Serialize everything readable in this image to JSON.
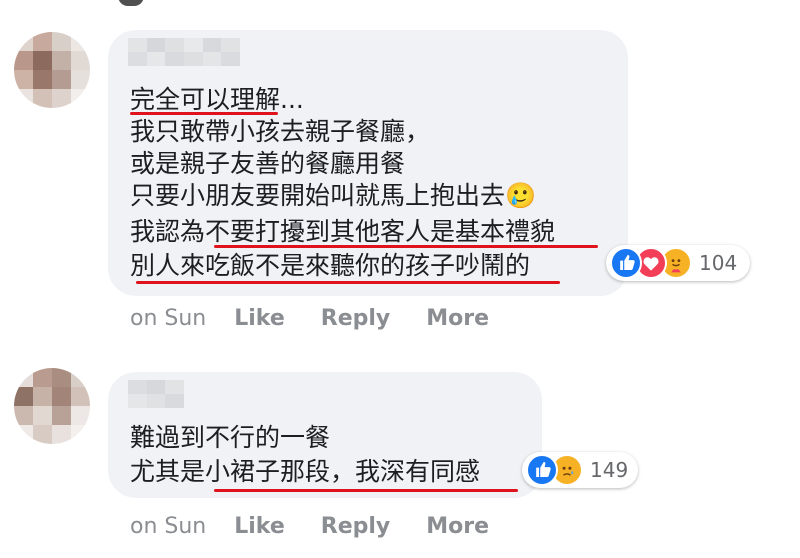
{
  "comments": [
    {
      "lines": [
        "完全可以理解...",
        "我只敢帶小孩去親子餐廳，",
        "或是親子友善的餐廳用餐",
        "只要小朋友要開始叫就馬上抱出去🥲",
        "我認為不要打擾到其他客人是基本禮貌",
        "別人來吃飯不是來聽你的孩子吵鬧的"
      ],
      "reactions": {
        "icons": [
          "like-icon",
          "love-icon",
          "care-icon"
        ],
        "count": "104"
      },
      "time": "on Sun",
      "actions": {
        "like": "Like",
        "reply": "Reply",
        "more": "More"
      }
    },
    {
      "lines": [
        "難過到不行的一餐",
        "尤其是小裙子那段，我深有同感"
      ],
      "reactions": {
        "icons": [
          "like-icon",
          "sad-icon"
        ],
        "count": "149"
      },
      "time": "on Sun",
      "actions": {
        "like": "Like",
        "reply": "Reply",
        "more": "More"
      }
    }
  ],
  "colors": {
    "bubble": "#f0f2f5",
    "text": "#1c1e21",
    "underline": "#e0121c",
    "meta": "#8a8d91",
    "like_blue": "#1877f2",
    "love_red": "#f33e58",
    "care_yellow": "#f7b125"
  }
}
